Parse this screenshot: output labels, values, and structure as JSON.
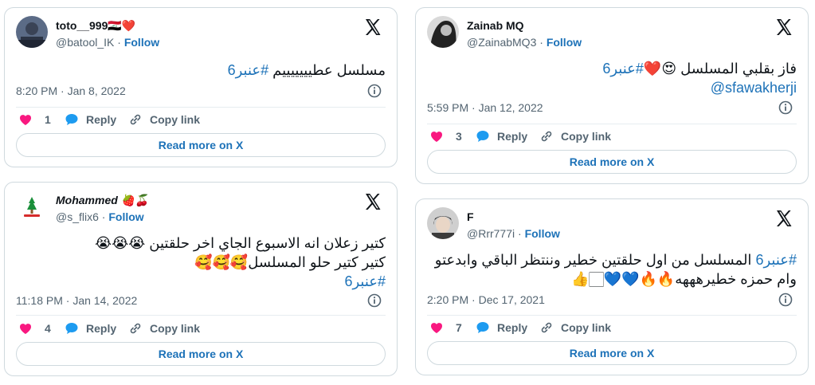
{
  "tweets": [
    {
      "name": "toto__999🇮🇶❤️",
      "handle": "@batool_IK",
      "follow_label": "Follow",
      "text": "مسلسل عطيييييييم ",
      "hashtag": "#عنبر6",
      "timestamp": "8:20 PM · Jan 8, 2022",
      "likes": "1",
      "reply_label": "Reply",
      "copy_label": "Copy link",
      "read_more_label": "Read more on X"
    },
    {
      "name": "Mohammed 🍓🍒",
      "handle": "@s_flix6",
      "follow_label": "Follow",
      "text_line1": "كتير زعلان انه الاسبوع الجاي اخر حلقتين 😭😭😭",
      "text_line2": "كتير كتير حلو المسلسل🥰🥰🥰",
      "hashtag": "#عنبر6",
      "timestamp": "11:18 PM · Jan 14, 2022",
      "likes": "4",
      "reply_label": "Reply",
      "copy_label": "Copy link",
      "read_more_label": "Read more on X"
    },
    {
      "name": "Zainab MQ",
      "handle": "@ZainabMQ3",
      "follow_label": "Follow",
      "text": "فاز بقلبي المسلسل 😍❤️",
      "hashtag": "#عنبر6",
      "mention": "@sfawakherji",
      "timestamp": "5:59 PM · Jan 12, 2022",
      "likes": "3",
      "reply_label": "Reply",
      "copy_label": "Copy link",
      "read_more_label": "Read more on X"
    },
    {
      "name": "F",
      "handle": "@Rrr777i",
      "follow_label": "Follow",
      "hashtag": "#عنبر6",
      "text_line1": " المسلسل من اول حلقتين خطير وننتظر الباقي وابدعتو",
      "text_line2": "وام حمزه خطيرهههه🔥🔥💙💙🏻👍",
      "timestamp": "2:20 PM · Dec 17, 2021",
      "likes": "7",
      "reply_label": "Reply",
      "copy_label": "Copy link",
      "read_more_label": "Read more on X"
    }
  ],
  "colors": {
    "link": "#1d72b8",
    "like": "#f91880",
    "reply": "#1d9bf0",
    "muted": "#536471",
    "border": "#cfd9de"
  },
  "icons": [
    "x-logo-icon",
    "info-icon",
    "heart-icon",
    "reply-bubble-icon",
    "link-icon"
  ]
}
